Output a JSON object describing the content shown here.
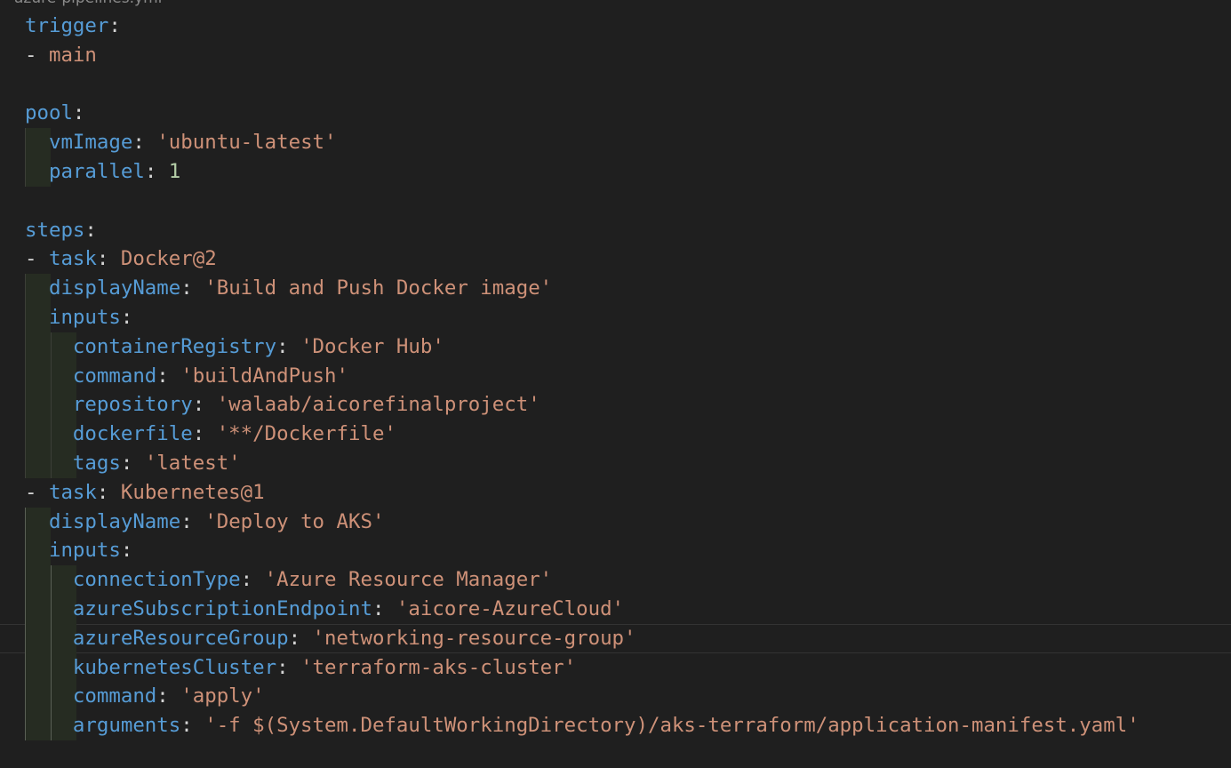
{
  "editor": {
    "tab_title": "azure-pipelines.yml"
  },
  "code": {
    "trigger": {
      "key": "trigger",
      "item": "main"
    },
    "pool": {
      "key": "pool",
      "vmImage_key": "vmImage",
      "vmImage_value": "'ubuntu-latest'",
      "parallel_key": "parallel",
      "parallel_value": "1"
    },
    "steps": {
      "key": "steps",
      "docker_task": {
        "task_key": "task",
        "task_value": "Docker@2",
        "displayName_key": "displayName",
        "displayName_value": "'Build and Push Docker image'",
        "inputs_key": "inputs",
        "containerRegistry_key": "containerRegistry",
        "containerRegistry_value": "'Docker Hub'",
        "command_key": "command",
        "command_value": "'buildAndPush'",
        "repository_key": "repository",
        "repository_value": "'walaab/aicorefinalproject'",
        "dockerfile_key": "dockerfile",
        "dockerfile_value": "'**/Dockerfile'",
        "tags_key": "tags",
        "tags_value": "'latest'"
      },
      "k8s_task": {
        "task_key": "task",
        "task_value": "Kubernetes@1",
        "displayName_key": "displayName",
        "displayName_value": "'Deploy to AKS'",
        "inputs_key": "inputs",
        "connectionType_key": "connectionType",
        "connectionType_value": "'Azure Resource Manager'",
        "azureSubscriptionEndpoint_key": "azureSubscriptionEndpoint",
        "azureSubscriptionEndpoint_value": "'aicore-AzureCloud'",
        "azureResourceGroup_key": "azureResourceGroup",
        "azureResourceGroup_value": "'networking-resource-group'",
        "kubernetesCluster_key": "kubernetesCluster",
        "kubernetesCluster_value": "'terraform-aks-cluster'",
        "command_key": "command",
        "command_value": "'apply'",
        "arguments_key": "arguments",
        "arguments_value": "'-f $(System.DefaultWorkingDirectory)/aks-terraform/application-manifest.yaml'"
      }
    }
  },
  "colors": {
    "background": "#1f1f1f",
    "key": "#569cd6",
    "string": "#ce9178",
    "number": "#b5cea8",
    "punctuation": "#d4d4d4"
  }
}
